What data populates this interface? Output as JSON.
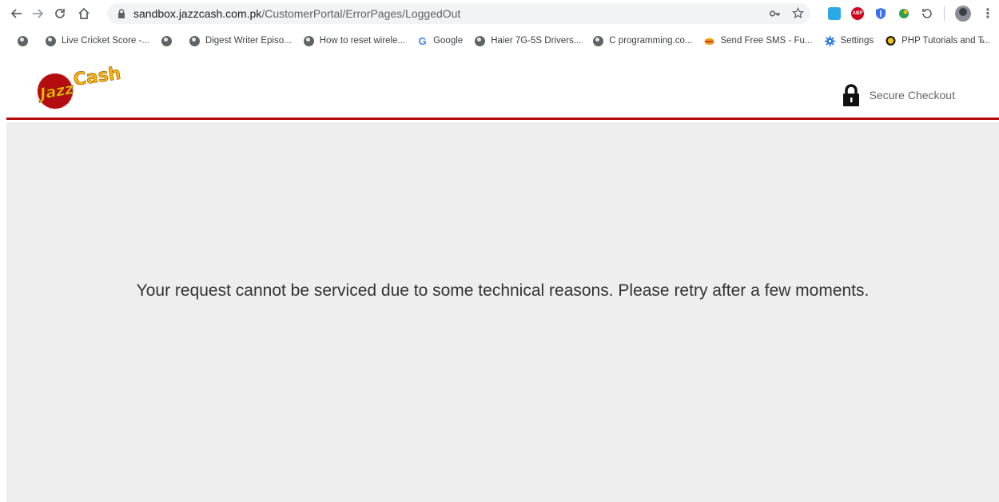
{
  "browser": {
    "url_host": "sandbox.jazzcash.com.pk",
    "url_path": "/CustomerPortal/ErrorPages/LoggedOut"
  },
  "bookmarks": [
    {
      "label": "",
      "icon": "globe-icon"
    },
    {
      "label": "Live Cricket Score -...",
      "icon": "globe-icon"
    },
    {
      "label": "",
      "icon": "globe-icon"
    },
    {
      "label": "Digest Writer Episo...",
      "icon": "globe-icon"
    },
    {
      "label": "How to reset wirele...",
      "icon": "globe-icon"
    },
    {
      "label": "Google",
      "icon": "google-icon"
    },
    {
      "label": "Haier 7G-5S Drivers...",
      "icon": "globe-icon"
    },
    {
      "label": "C programming.co...",
      "icon": "globe-icon"
    },
    {
      "label": "Send Free SMS - Fu...",
      "icon": "sms-icon"
    },
    {
      "label": "Settings",
      "icon": "settings-gear-icon"
    },
    {
      "label": "PHP Tutorials and T...",
      "icon": "php-icon"
    }
  ],
  "bookmarks_more": "»",
  "header": {
    "logo_text_1": "Jazz",
    "logo_text_2": "Cash",
    "secure_label": "Secure Checkout"
  },
  "main": {
    "message": "Your request cannot be serviced due to some technical reasons. Please retry after a few moments."
  },
  "colors": {
    "brand_red": "#b30d12",
    "logo_yellow": "#f7b500",
    "page_bg": "#eeeeee"
  }
}
